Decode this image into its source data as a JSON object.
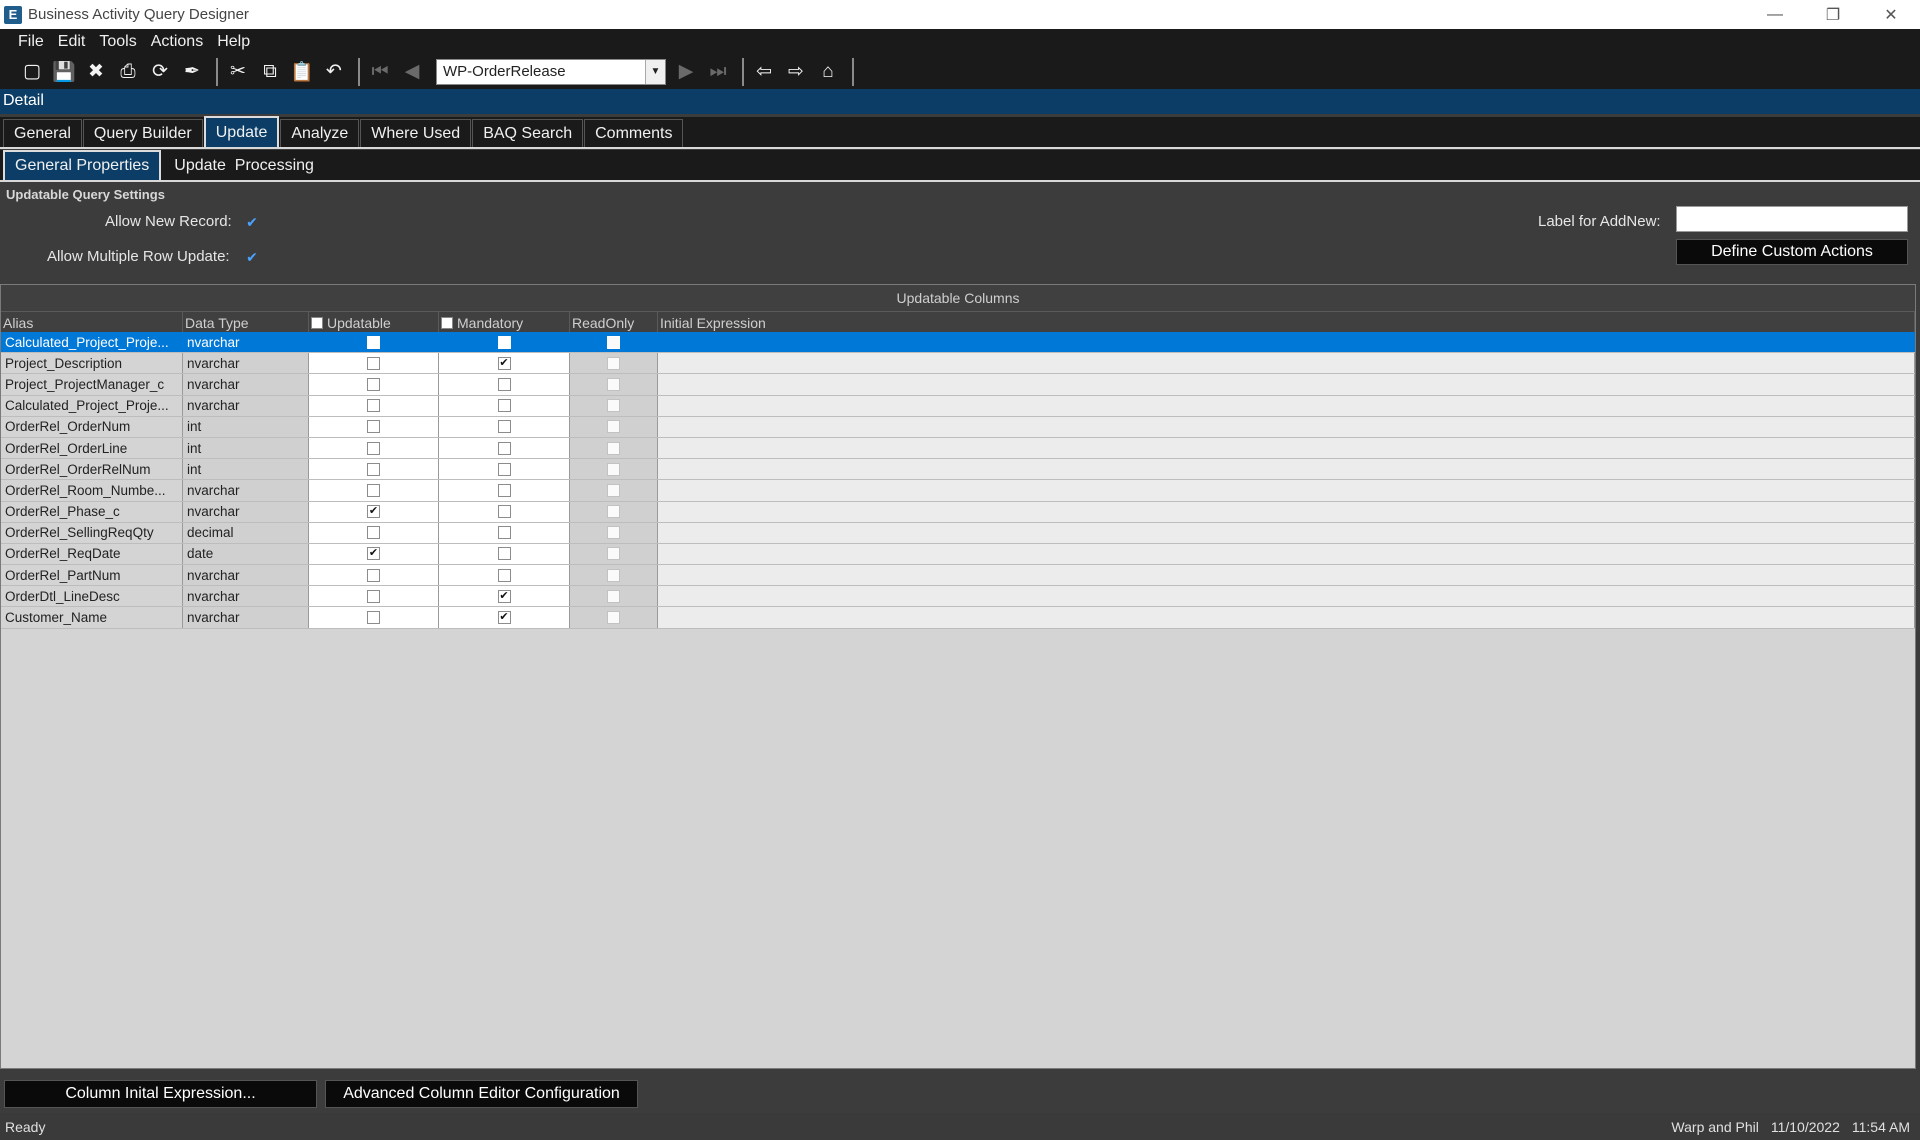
{
  "window": {
    "title": "Business Activity Query Designer",
    "icon_letter": "E"
  },
  "menu": [
    "File",
    "Edit",
    "Tools",
    "Actions",
    "Help"
  ],
  "toolbar": {
    "combo_value": "WP-OrderRelease"
  },
  "detail_header": "Detail",
  "tabs": [
    "General",
    "Query Builder",
    "Update",
    "Analyze",
    "Where Used",
    "BAQ Search",
    "Comments"
  ],
  "subtabs": [
    "General Properties",
    "Update  Processing"
  ],
  "settings": {
    "title": "Updatable Query Settings",
    "allow_new_record_label": "Allow New Record:",
    "allow_multiple_row_label": "Allow Multiple Row Update:",
    "label_addnew": "Label for AddNew:",
    "define_custom_actions": "Define Custom Actions"
  },
  "grid": {
    "group_title": "Updatable Columns",
    "headers": {
      "alias": "Alias",
      "data_type": "Data Type",
      "updatable": "Updatable",
      "mandatory": "Mandatory",
      "readonly": "ReadOnly",
      "initial_expression": "Initial Expression"
    },
    "rows": [
      {
        "alias": "Calculated_Project_Proje...",
        "type": "nvarchar",
        "updatable": false,
        "mandatory": false,
        "selected": true
      },
      {
        "alias": "Project_Description",
        "type": "nvarchar",
        "updatable": false,
        "mandatory": true
      },
      {
        "alias": "Project_ProjectManager_c",
        "type": "nvarchar",
        "updatable": false,
        "mandatory": false
      },
      {
        "alias": "Calculated_Project_Proje...",
        "type": "nvarchar",
        "updatable": false,
        "mandatory": false
      },
      {
        "alias": "OrderRel_OrderNum",
        "type": "int",
        "updatable": false,
        "mandatory": false
      },
      {
        "alias": "OrderRel_OrderLine",
        "type": "int",
        "updatable": false,
        "mandatory": false
      },
      {
        "alias": "OrderRel_OrderRelNum",
        "type": "int",
        "updatable": false,
        "mandatory": false
      },
      {
        "alias": "OrderRel_Room_Numbe...",
        "type": "nvarchar",
        "updatable": false,
        "mandatory": false
      },
      {
        "alias": "OrderRel_Phase_c",
        "type": "nvarchar",
        "updatable": true,
        "mandatory": false
      },
      {
        "alias": "OrderRel_SellingReqQty",
        "type": "decimal",
        "updatable": false,
        "mandatory": false
      },
      {
        "alias": "OrderRel_ReqDate",
        "type": "date",
        "updatable": true,
        "mandatory": false
      },
      {
        "alias": "OrderRel_PartNum",
        "type": "nvarchar",
        "updatable": false,
        "mandatory": false
      },
      {
        "alias": "OrderDtl_LineDesc",
        "type": "nvarchar",
        "updatable": false,
        "mandatory": true
      },
      {
        "alias": "Customer_Name",
        "type": "nvarchar",
        "updatable": false,
        "mandatory": true
      }
    ]
  },
  "buttons": {
    "column_initial": "Column Inital Expression...",
    "advanced_editor": "Advanced Column Editor Configuration"
  },
  "status": {
    "left": "Ready",
    "user": "Warp and Phil",
    "date": "11/10/2022",
    "time": "11:54 AM"
  },
  "colors": {
    "accent": "#0b3d66",
    "selection": "#0078d7"
  }
}
